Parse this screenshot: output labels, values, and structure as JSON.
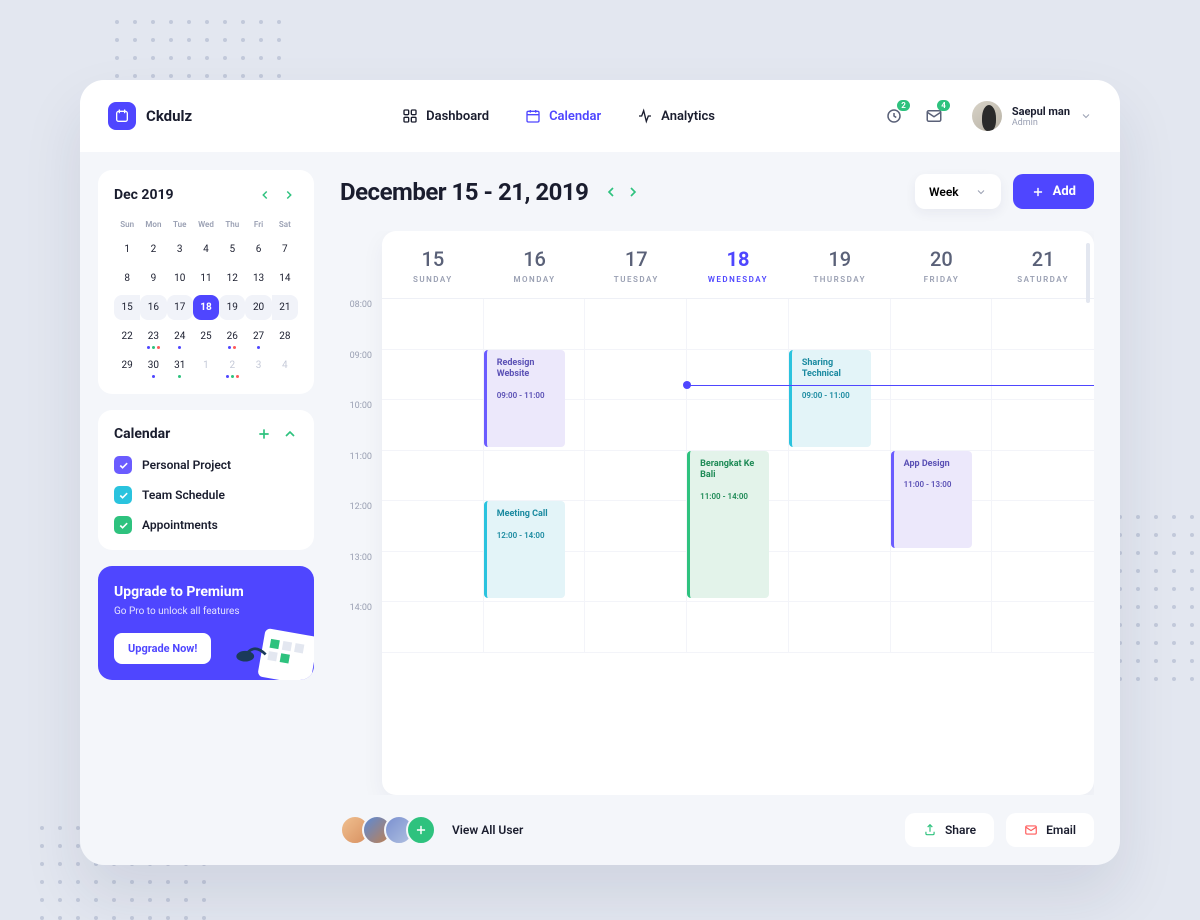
{
  "brand": "Ckdulz",
  "nav": {
    "dashboard": "Dashboard",
    "calendar": "Calendar",
    "analytics": "Analytics"
  },
  "notifBadge1": "2",
  "notifBadge2": "4",
  "user": {
    "name": "Saepul man",
    "role": "Admin"
  },
  "miniCal": {
    "title": "Dec 2019",
    "dow": [
      "Sun",
      "Mon",
      "Tue",
      "Wed",
      "Thu",
      "Fri",
      "Sat"
    ],
    "weeks": [
      {
        "hl": false,
        "days": [
          {
            "n": "1"
          },
          {
            "n": "2"
          },
          {
            "n": "3"
          },
          {
            "n": "4"
          },
          {
            "n": "5"
          },
          {
            "n": "6"
          },
          {
            "n": "7"
          }
        ]
      },
      {
        "hl": false,
        "days": [
          {
            "n": "8"
          },
          {
            "n": "9"
          },
          {
            "n": "10"
          },
          {
            "n": "11"
          },
          {
            "n": "12"
          },
          {
            "n": "13"
          },
          {
            "n": "14"
          }
        ]
      },
      {
        "hl": true,
        "days": [
          {
            "n": "15"
          },
          {
            "n": "16"
          },
          {
            "n": "17"
          },
          {
            "n": "18",
            "sel": true
          },
          {
            "n": "19"
          },
          {
            "n": "20"
          },
          {
            "n": "21"
          }
        ]
      },
      {
        "hl": false,
        "days": [
          {
            "n": "22"
          },
          {
            "n": "23",
            "dots": [
              "#4f46ff",
              "#2ec27e",
              "#ff5a5a"
            ]
          },
          {
            "n": "24",
            "dots": [
              "#4f46ff"
            ]
          },
          {
            "n": "25"
          },
          {
            "n": "26",
            "dots": [
              "#4f46ff",
              "#ff5a5a"
            ]
          },
          {
            "n": "27",
            "dots": [
              "#4f46ff"
            ]
          },
          {
            "n": "28"
          }
        ]
      },
      {
        "hl": false,
        "days": [
          {
            "n": "29"
          },
          {
            "n": "30",
            "dots": [
              "#4f46ff"
            ]
          },
          {
            "n": "31",
            "dots": [
              "#2ec27e"
            ]
          },
          {
            "n": "1",
            "muted": true
          },
          {
            "n": "2",
            "muted": true,
            "dots": [
              "#4f46ff",
              "#2ec27e",
              "#ff5a5a"
            ]
          },
          {
            "n": "3",
            "muted": true
          },
          {
            "n": "4",
            "muted": true
          }
        ]
      }
    ]
  },
  "calList": {
    "title": "Calendar",
    "items": [
      {
        "label": "Personal Project",
        "color": "#6b5cff"
      },
      {
        "label": "Team Schedule",
        "color": "#2ac3de"
      },
      {
        "label": "Appointments",
        "color": "#2ec27e"
      }
    ]
  },
  "promo": {
    "title": "Upgrade to Premium",
    "sub": "Go Pro to unlock all features",
    "cta": "Upgrade Now!"
  },
  "rangeTitle": "December 15 - 21, 2019",
  "viewSelect": "Week",
  "addLabel": "Add",
  "days": [
    {
      "num": "15",
      "lab": "SUNDAY"
    },
    {
      "num": "16",
      "lab": "MONDAY"
    },
    {
      "num": "17",
      "lab": "TUESDAY"
    },
    {
      "num": "18",
      "lab": "WEDNESDAY",
      "active": true
    },
    {
      "num": "19",
      "lab": "THURSDAY"
    },
    {
      "num": "20",
      "lab": "FRIDAY"
    },
    {
      "num": "21",
      "lab": "SATURDAY"
    }
  ],
  "times": [
    "08:00",
    "09:00",
    "10:00",
    "11:00",
    "12:00",
    "13:00",
    "14:00"
  ],
  "events": [
    {
      "title": "Redesign Website",
      "time": "09:00 - 11:00",
      "col": 1,
      "start": 9,
      "end": 11,
      "bg": "#ece8fb",
      "bar": "#6b5cff",
      "fg": "#5a50b5"
    },
    {
      "title": "Meeting Call",
      "time": "12:00 - 14:00",
      "col": 1,
      "start": 12,
      "end": 14,
      "bg": "#e3f4f8",
      "bar": "#2ac3de",
      "fg": "#1a8aa0"
    },
    {
      "title": "Berangkat Ke Bali",
      "time": "11:00 - 14:00",
      "col": 3,
      "start": 11,
      "end": 14,
      "bg": "#e3f3ea",
      "bar": "#2ec27e",
      "fg": "#1e8a56"
    },
    {
      "title": "Sharing Technical",
      "time": "09:00 - 11:00",
      "col": 4,
      "start": 9,
      "end": 11,
      "bg": "#e3f4f8",
      "bar": "#2ac3de",
      "fg": "#1a8aa0"
    },
    {
      "title": "App Design",
      "time": "11:00 - 13:00",
      "col": 5,
      "start": 11,
      "end": 13,
      "bg": "#ece8fb",
      "bar": "#6b5cff",
      "fg": "#5a50b5"
    }
  ],
  "nowLine": {
    "col": 3,
    "hour": 9.7
  },
  "viewAll": "View All User",
  "shareLabel": "Share",
  "emailLabel": "Email"
}
